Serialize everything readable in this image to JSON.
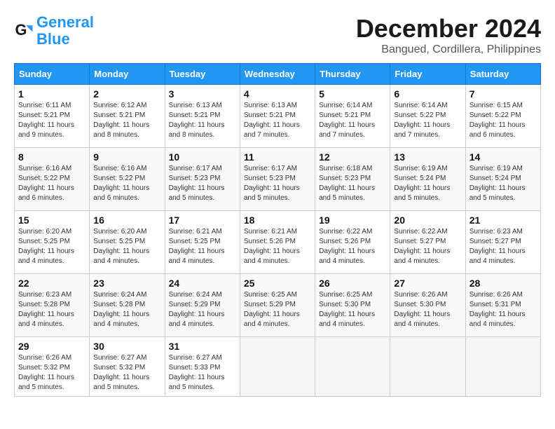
{
  "logo": {
    "text1": "General",
    "text2": "Blue"
  },
  "title": "December 2024",
  "location": "Bangued, Cordillera, Philippines",
  "weekdays": [
    "Sunday",
    "Monday",
    "Tuesday",
    "Wednesday",
    "Thursday",
    "Friday",
    "Saturday"
  ],
  "weeks": [
    [
      {
        "day": "1",
        "sunrise": "6:11 AM",
        "sunset": "5:21 PM",
        "daylight": "11 hours and 9 minutes."
      },
      {
        "day": "2",
        "sunrise": "6:12 AM",
        "sunset": "5:21 PM",
        "daylight": "11 hours and 8 minutes."
      },
      {
        "day": "3",
        "sunrise": "6:13 AM",
        "sunset": "5:21 PM",
        "daylight": "11 hours and 8 minutes."
      },
      {
        "day": "4",
        "sunrise": "6:13 AM",
        "sunset": "5:21 PM",
        "daylight": "11 hours and 7 minutes."
      },
      {
        "day": "5",
        "sunrise": "6:14 AM",
        "sunset": "5:21 PM",
        "daylight": "11 hours and 7 minutes."
      },
      {
        "day": "6",
        "sunrise": "6:14 AM",
        "sunset": "5:22 PM",
        "daylight": "11 hours and 7 minutes."
      },
      {
        "day": "7",
        "sunrise": "6:15 AM",
        "sunset": "5:22 PM",
        "daylight": "11 hours and 6 minutes."
      }
    ],
    [
      {
        "day": "8",
        "sunrise": "6:16 AM",
        "sunset": "5:22 PM",
        "daylight": "11 hours and 6 minutes."
      },
      {
        "day": "9",
        "sunrise": "6:16 AM",
        "sunset": "5:22 PM",
        "daylight": "11 hours and 6 minutes."
      },
      {
        "day": "10",
        "sunrise": "6:17 AM",
        "sunset": "5:23 PM",
        "daylight": "11 hours and 5 minutes."
      },
      {
        "day": "11",
        "sunrise": "6:17 AM",
        "sunset": "5:23 PM",
        "daylight": "11 hours and 5 minutes."
      },
      {
        "day": "12",
        "sunrise": "6:18 AM",
        "sunset": "5:23 PM",
        "daylight": "11 hours and 5 minutes."
      },
      {
        "day": "13",
        "sunrise": "6:19 AM",
        "sunset": "5:24 PM",
        "daylight": "11 hours and 5 minutes."
      },
      {
        "day": "14",
        "sunrise": "6:19 AM",
        "sunset": "5:24 PM",
        "daylight": "11 hours and 5 minutes."
      }
    ],
    [
      {
        "day": "15",
        "sunrise": "6:20 AM",
        "sunset": "5:25 PM",
        "daylight": "11 hours and 4 minutes."
      },
      {
        "day": "16",
        "sunrise": "6:20 AM",
        "sunset": "5:25 PM",
        "daylight": "11 hours and 4 minutes."
      },
      {
        "day": "17",
        "sunrise": "6:21 AM",
        "sunset": "5:25 PM",
        "daylight": "11 hours and 4 minutes."
      },
      {
        "day": "18",
        "sunrise": "6:21 AM",
        "sunset": "5:26 PM",
        "daylight": "11 hours and 4 minutes."
      },
      {
        "day": "19",
        "sunrise": "6:22 AM",
        "sunset": "5:26 PM",
        "daylight": "11 hours and 4 minutes."
      },
      {
        "day": "20",
        "sunrise": "6:22 AM",
        "sunset": "5:27 PM",
        "daylight": "11 hours and 4 minutes."
      },
      {
        "day": "21",
        "sunrise": "6:23 AM",
        "sunset": "5:27 PM",
        "daylight": "11 hours and 4 minutes."
      }
    ],
    [
      {
        "day": "22",
        "sunrise": "6:23 AM",
        "sunset": "5:28 PM",
        "daylight": "11 hours and 4 minutes."
      },
      {
        "day": "23",
        "sunrise": "6:24 AM",
        "sunset": "5:28 PM",
        "daylight": "11 hours and 4 minutes."
      },
      {
        "day": "24",
        "sunrise": "6:24 AM",
        "sunset": "5:29 PM",
        "daylight": "11 hours and 4 minutes."
      },
      {
        "day": "25",
        "sunrise": "6:25 AM",
        "sunset": "5:29 PM",
        "daylight": "11 hours and 4 minutes."
      },
      {
        "day": "26",
        "sunrise": "6:25 AM",
        "sunset": "5:30 PM",
        "daylight": "11 hours and 4 minutes."
      },
      {
        "day": "27",
        "sunrise": "6:26 AM",
        "sunset": "5:30 PM",
        "daylight": "11 hours and 4 minutes."
      },
      {
        "day": "28",
        "sunrise": "6:26 AM",
        "sunset": "5:31 PM",
        "daylight": "11 hours and 4 minutes."
      }
    ],
    [
      {
        "day": "29",
        "sunrise": "6:26 AM",
        "sunset": "5:32 PM",
        "daylight": "11 hours and 5 minutes."
      },
      {
        "day": "30",
        "sunrise": "6:27 AM",
        "sunset": "5:32 PM",
        "daylight": "11 hours and 5 minutes."
      },
      {
        "day": "31",
        "sunrise": "6:27 AM",
        "sunset": "5:33 PM",
        "daylight": "11 hours and 5 minutes."
      },
      null,
      null,
      null,
      null
    ]
  ],
  "labels": {
    "sunrise": "Sunrise:",
    "sunset": "Sunset:",
    "daylight": "Daylight:"
  }
}
